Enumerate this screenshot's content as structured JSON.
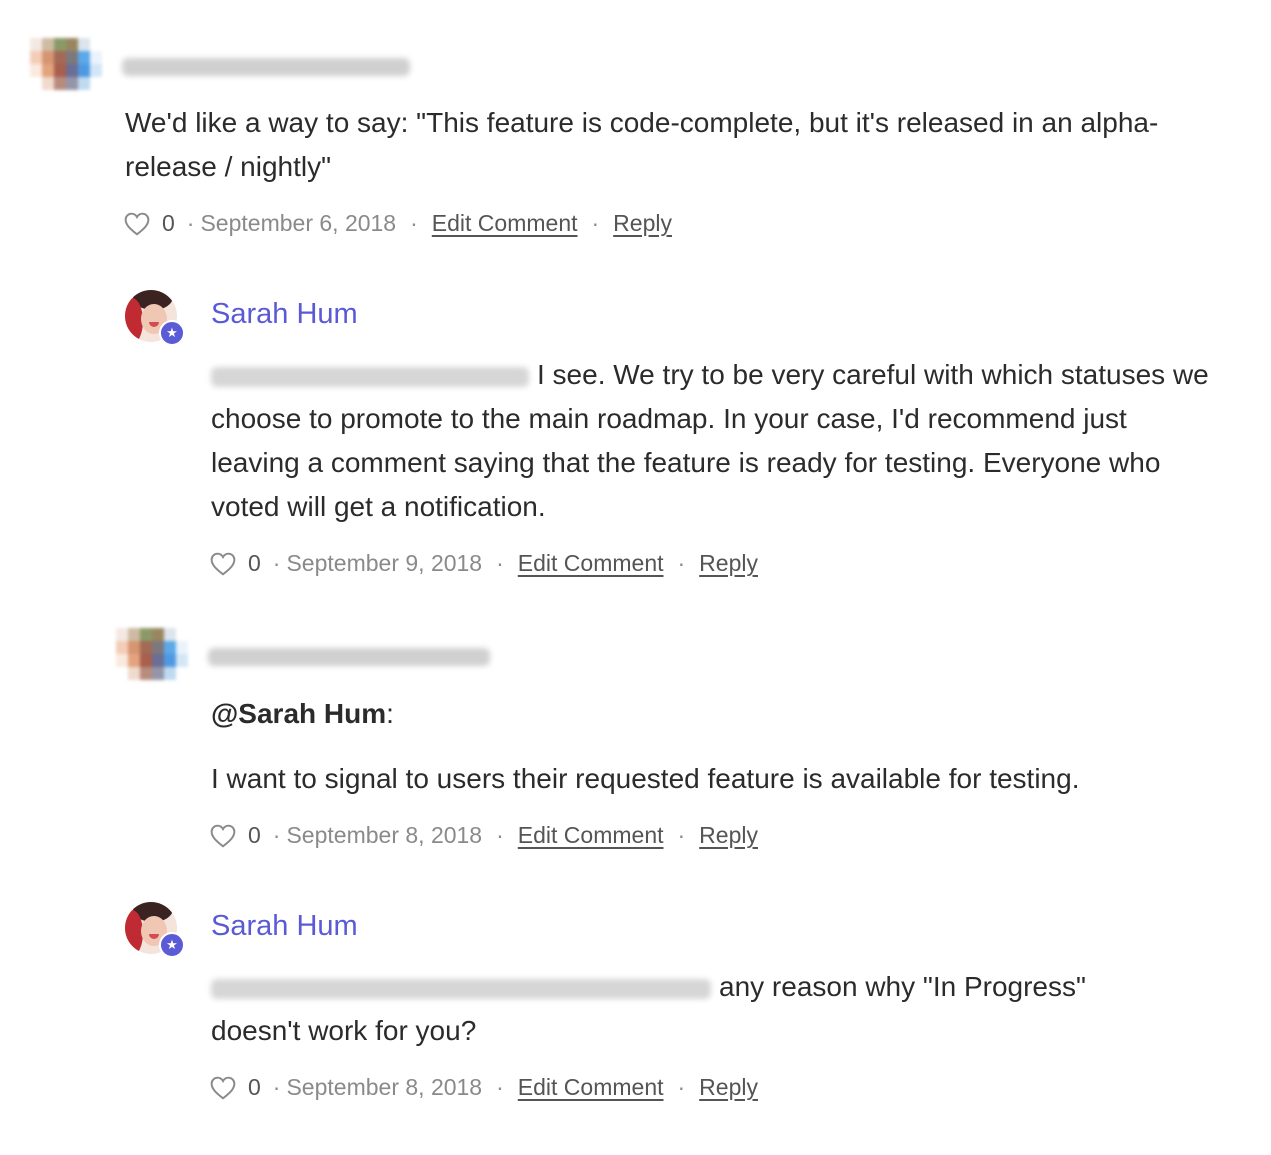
{
  "comments": [
    {
      "author": "",
      "author_type": "blurred",
      "text": "We'd like a way to say: \"This feature is code-complete, but it's released in an alpha-release / nightly\"",
      "likes": "0",
      "date": "September 6, 2018",
      "edit_label": "Edit Comment",
      "reply_label": "Reply"
    },
    {
      "author": "Sarah Hum",
      "author_type": "admin",
      "text": "I see. We try to be very careful with which statuses we choose to promote to the main roadmap. In your case, I'd recommend just leaving a comment saying that the feature is ready for testing. Everyone who voted will get a notification.",
      "likes": "0",
      "date": "September 9, 2018",
      "edit_label": "Edit Comment",
      "reply_label": "Reply"
    },
    {
      "author": "",
      "author_type": "blurred",
      "mention": "@Sarah Hum",
      "mention_suffix": ":",
      "text": "I want to signal to users their requested feature is available for testing.",
      "likes": "0",
      "date": "September 8, 2018",
      "edit_label": "Edit Comment",
      "reply_label": "Reply"
    },
    {
      "author": "Sarah Hum",
      "author_type": "admin",
      "text_line1": "any reason why \"In Progress\"",
      "text_line2": "doesn't work for you?",
      "likes": "0",
      "date": "September 8, 2018",
      "edit_label": "Edit Comment",
      "reply_label": "Reply"
    }
  ],
  "separator": "·",
  "icons": {
    "like": "heart-outline-icon",
    "admin_badge": "star-badge-icon"
  },
  "colors": {
    "accent": "#5b5bd6",
    "text": "#2b2b2b",
    "meta": "#8a8a8a"
  }
}
